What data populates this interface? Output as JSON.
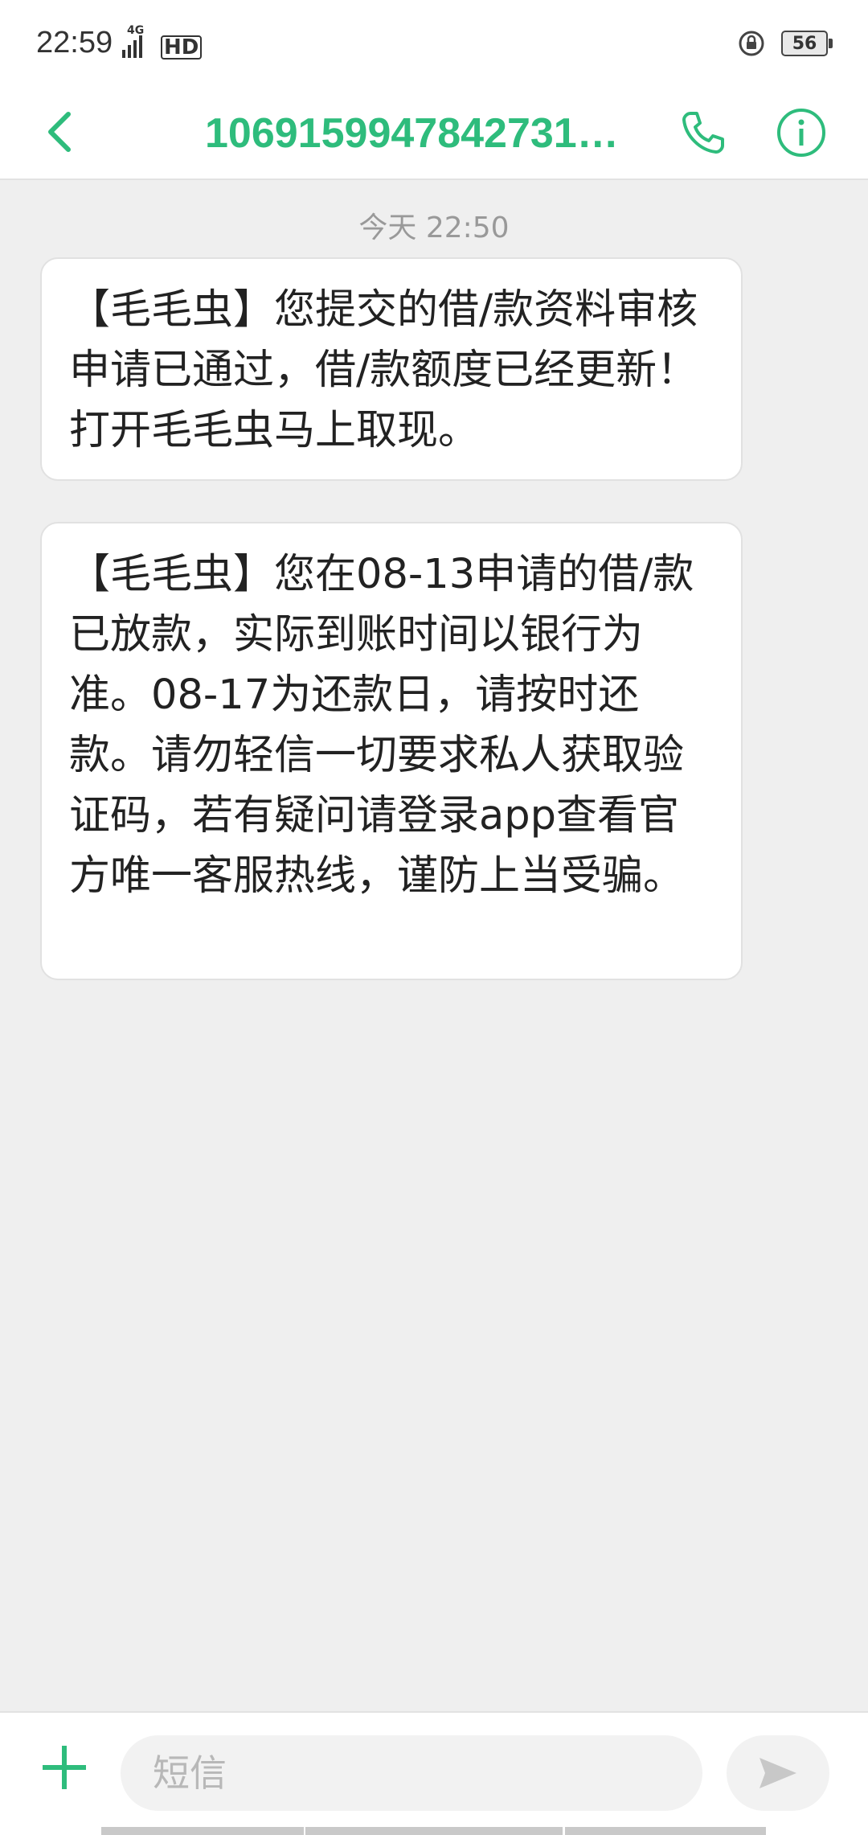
{
  "status_bar": {
    "time": "22:59",
    "network": "4G",
    "hd": "HD",
    "battery": "56"
  },
  "app_bar": {
    "title": "1069159947842731…"
  },
  "conversation": {
    "timestamp": "今天 22:50",
    "messages": [
      {
        "text": "【毛毛虫】您提交的借/款资料审核申请已通过，借/款额度已经更新！打开毛毛虫马上取现。"
      },
      {
        "text": "【毛毛虫】您在08-13申请的借/款已放款，实际到账时间以银行为准。08-17为还款日，请按时还款。请勿轻信一切要求私人获取验证码，若有疑问请登录app查看官方唯一客服热线，谨防上当受骗。"
      }
    ]
  },
  "input_bar": {
    "placeholder": "短信",
    "value": ""
  },
  "colors": {
    "accent": "#2ebc7c",
    "background": "#efefef",
    "bubble": "#ffffff"
  },
  "icons": {
    "back": "chevron-left-icon",
    "call": "phone-icon",
    "info": "info-icon",
    "add": "plus-icon",
    "send": "send-icon"
  }
}
